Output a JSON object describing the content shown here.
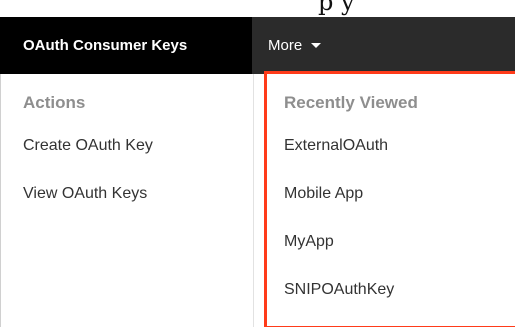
{
  "header_fragment": "         p                      y",
  "nav": {
    "active_tab": "OAuth Consumer Keys",
    "more_label": "More"
  },
  "actions": {
    "header": "Actions",
    "items": [
      {
        "label": "Create OAuth Key"
      },
      {
        "label": "View OAuth Keys"
      }
    ]
  },
  "recently_viewed": {
    "header": "Recently Viewed",
    "items": [
      {
        "label": "ExternalOAuth"
      },
      {
        "label": "Mobile App"
      },
      {
        "label": "MyApp"
      },
      {
        "label": "SNIPOAuthKey"
      }
    ]
  },
  "colors": {
    "navbar": "#2b2b2b",
    "active_tab": "#000000",
    "highlight": "#ff3b1a",
    "header_text": "#8e8e8e"
  },
  "icons": {
    "more_caret": "chevron-down-icon"
  }
}
